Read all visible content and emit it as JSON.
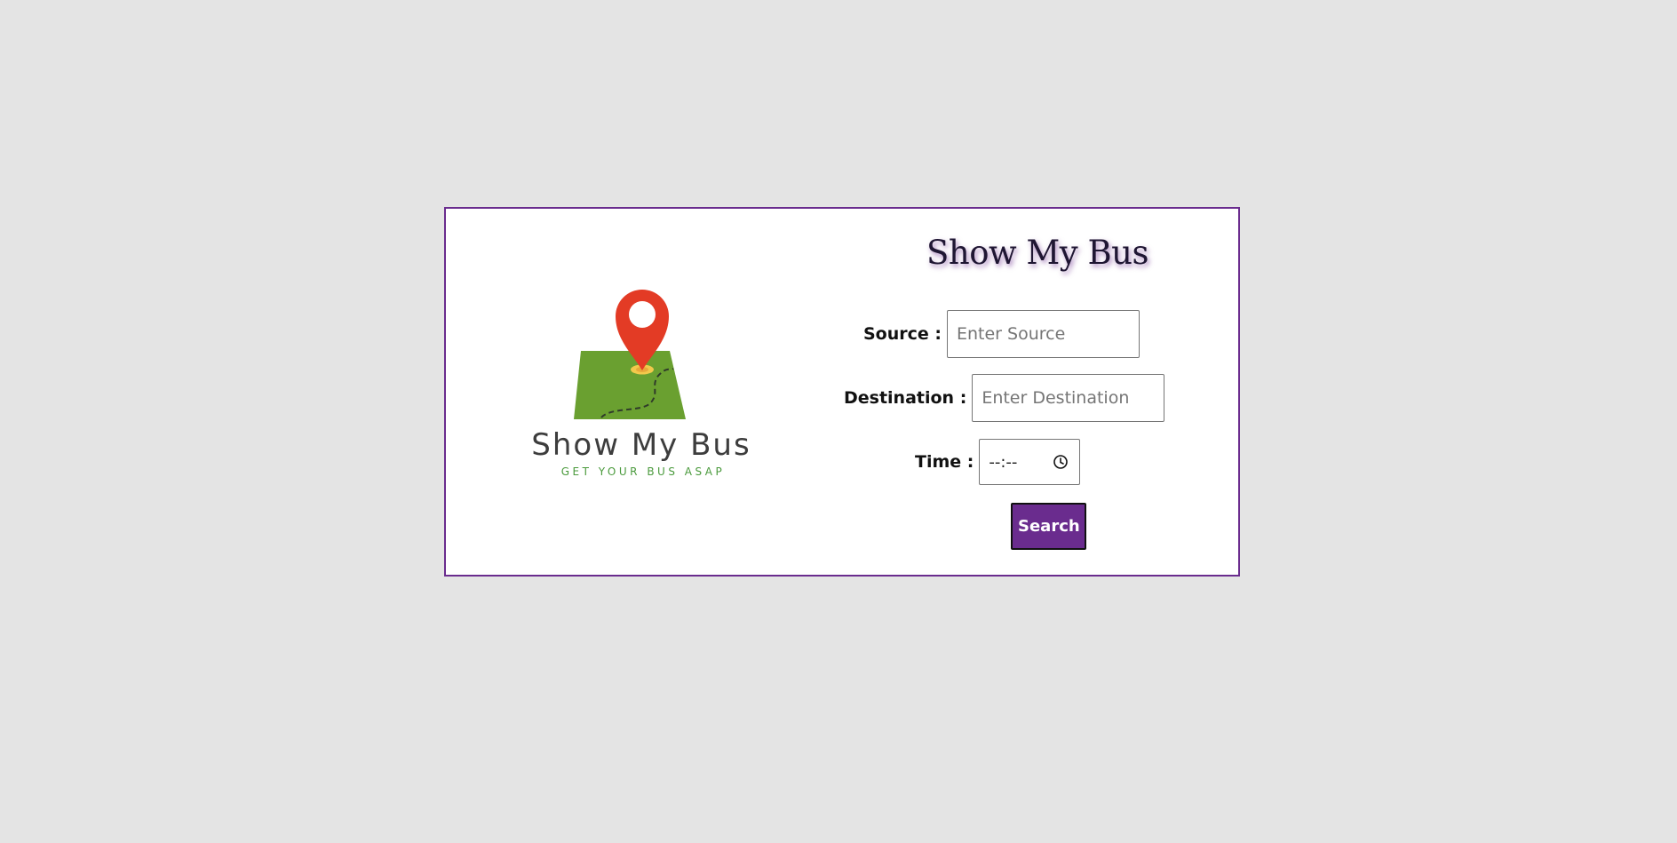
{
  "logo": {
    "brand": "Show My Bus",
    "tagline": "GET YOUR BUS ASAP"
  },
  "header": {
    "title": "Show My Bus"
  },
  "form": {
    "source_label": "Source :",
    "source_placeholder": "Enter Source",
    "destination_label": "Destination :",
    "destination_placeholder": "Enter Destination",
    "time_label": "Time :",
    "time_value": "--:--",
    "search_label": "Search"
  },
  "colors": {
    "accent": "#6a2c8e",
    "background": "#e4e4e4",
    "pin": "#e33b25",
    "map": "#6aa030"
  },
  "icons": {
    "map_pin": "map-pin-icon",
    "clock": "clock-icon"
  }
}
